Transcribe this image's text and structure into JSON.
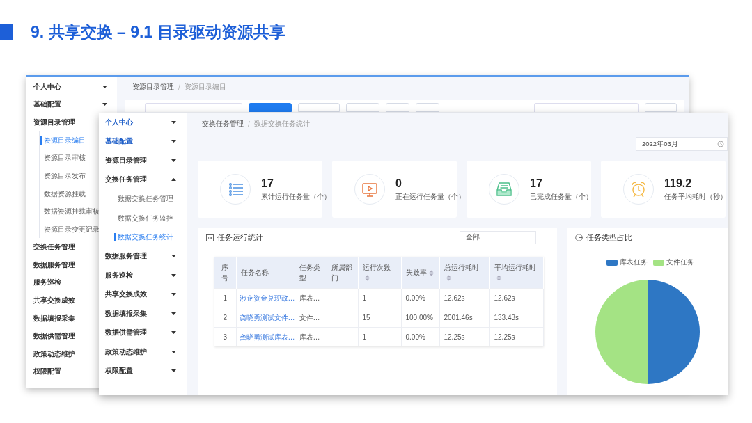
{
  "title": "9. 共享交换 – 9.1 目录驱动资源共享",
  "back_window": {
    "sidebar": {
      "items": [
        {
          "label": "个人中心",
          "kind": "group",
          "expanded": false
        },
        {
          "label": "基础配置",
          "kind": "group",
          "expanded": false
        },
        {
          "label": "资源目录管理",
          "kind": "heading",
          "children": [
            {
              "label": "资源目录编目",
              "selected": true
            },
            {
              "label": "资源目录审核",
              "selected": false
            },
            {
              "label": "资源目录发布",
              "selected": false
            },
            {
              "label": "数据资源挂载",
              "selected": false
            },
            {
              "label": "数据资源挂载审核",
              "selected": false
            },
            {
              "label": "资源目录变更记录",
              "selected": false
            }
          ]
        },
        {
          "label": "交换任务管理",
          "kind": "heading"
        },
        {
          "label": "数据服务管理",
          "kind": "heading"
        },
        {
          "label": "服务巡检",
          "kind": "heading"
        },
        {
          "label": "共享交换成效",
          "kind": "heading"
        },
        {
          "label": "数据填报采集",
          "kind": "heading"
        },
        {
          "label": "数据供需管理",
          "kind": "heading"
        },
        {
          "label": "政策动态维护",
          "kind": "heading"
        },
        {
          "label": "权限配置",
          "kind": "heading"
        }
      ]
    },
    "breadcrumb": {
      "items": [
        "资源目录管理",
        "资源目录编目"
      ],
      "separator": "/"
    },
    "toolbar": [
      {
        "kind": "search"
      },
      {
        "kind": "primary"
      },
      {
        "kind": "plain"
      },
      {
        "kind": "plain"
      },
      {
        "kind": "plain"
      },
      {
        "kind": "plain"
      },
      {
        "kind": "spacer"
      },
      {
        "kind": "wide_search"
      },
      {
        "kind": "plain"
      }
    ]
  },
  "front_window": {
    "sidebar": {
      "items": [
        {
          "label": "个人中心",
          "kind": "group",
          "expanded": false,
          "highlighted": true
        },
        {
          "label": "基础配置",
          "kind": "group",
          "expanded": false,
          "highlighted": true
        },
        {
          "label": "资源目录管理",
          "kind": "group",
          "expanded": false,
          "highlighted": false
        },
        {
          "label": "交换任务管理",
          "kind": "group",
          "expanded": true,
          "highlighted": false,
          "children": [
            {
              "label": "数据交换任务管理",
              "selected": false
            },
            {
              "label": "数据交换任务监控",
              "selected": false
            },
            {
              "label": "数据交换任务统计",
              "selected": true
            }
          ]
        },
        {
          "label": "数据服务管理",
          "kind": "group",
          "expanded": false,
          "highlighted": false
        },
        {
          "label": "服务巡检",
          "kind": "group",
          "expanded": false,
          "highlighted": false
        },
        {
          "label": "共享交换成效",
          "kind": "group",
          "expanded": false,
          "highlighted": false
        },
        {
          "label": "数据填报采集",
          "kind": "group",
          "expanded": false,
          "highlighted": false
        },
        {
          "label": "数据供需管理",
          "kind": "group",
          "expanded": false,
          "highlighted": false
        },
        {
          "label": "政策动态维护",
          "kind": "group",
          "expanded": false,
          "highlighted": false
        },
        {
          "label": "权限配置",
          "kind": "group",
          "expanded": false,
          "highlighted": false
        }
      ]
    },
    "breadcrumb": {
      "items": [
        "交换任务管理",
        "数据交换任务统计"
      ],
      "separator": "/"
    },
    "month_picker": {
      "value": "2022年03月"
    },
    "stats": [
      {
        "value": "17",
        "label": "累计运行任务量（个）",
        "kind": "total"
      },
      {
        "value": "0",
        "label": "正在运行任务量（个）",
        "kind": "running"
      },
      {
        "value": "17",
        "label": "已完成任务量（个）",
        "kind": "done"
      },
      {
        "value": "119.2",
        "label": "任务平均耗时（秒）",
        "kind": "duration"
      }
    ],
    "task_panel": {
      "title": "任务运行统计",
      "filter": {
        "value": "全部"
      },
      "table": {
        "columns": [
          {
            "label": "序号",
            "sortable": false
          },
          {
            "label": "任务名称",
            "sortable": false
          },
          {
            "label": "任务类型",
            "sortable": false
          },
          {
            "label": "所属部门",
            "sortable": false
          },
          {
            "label": "运行次数",
            "sortable": true
          },
          {
            "label": "失败率",
            "sortable": true
          },
          {
            "label": "总运行耗时",
            "sortable": true
          },
          {
            "label": "平均运行耗时",
            "sortable": true
          }
        ],
        "rows": [
          [
            "1",
            "涉企资金兑现政…",
            "库表…",
            "",
            "1",
            "0.00%",
            "12.62s",
            "12.62s"
          ],
          [
            "2",
            "龚晓勇测试文件…",
            "文件…",
            "",
            "15",
            "100.00%",
            "2001.46s",
            "133.43s"
          ],
          [
            "3",
            "龚晓勇测试库表…",
            "库表…",
            "",
            "1",
            "0.00%",
            "12.25s",
            "12.25s"
          ]
        ]
      }
    },
    "type_panel": {
      "title": "任务类型占比",
      "chart_data": {
        "type": "pie",
        "categories": [
          "库表任务",
          "文件任务"
        ],
        "values": [
          50,
          50
        ],
        "colors": [
          "#2e77c4",
          "#a4e384"
        ],
        "legend": "top"
      }
    }
  }
}
